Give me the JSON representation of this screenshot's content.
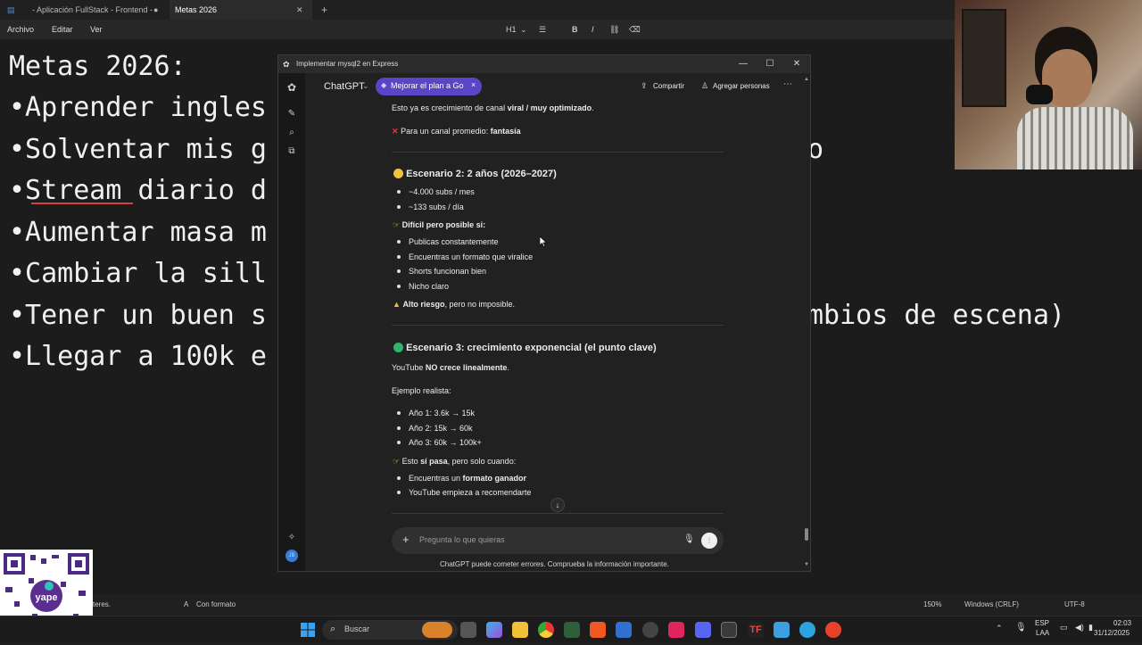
{
  "notepad": {
    "tabs": [
      "- Aplicación FullStack - Frontend -",
      "Metas 2026"
    ],
    "menu": [
      "Archivo",
      "Editar",
      "Ver"
    ],
    "toolbar": [
      "H1",
      "B",
      "I"
    ],
    "lines": [
      "Metas 2026:",
      "•Aprender ingles",
      "•Solventar mis g",
      "•Stream diario d",
      "•Aumentar masa m",
      "•Cambiar la sill",
      "•Tener un buen s",
      "•Llegar a 100k e"
    ],
    "right_fragments": [
      "o",
      "mbios de escena)"
    ],
    "status": {
      "left": "teres.",
      "format": "Con formato",
      "zoom": "150%",
      "eol": "Windows (CRLF)",
      "encoding": "UTF-8"
    }
  },
  "window": {
    "title": "Implementar mysql2 en Express",
    "controls": [
      "—",
      "☐",
      "✕"
    ]
  },
  "chat": {
    "model": "ChatGPT",
    "upgrade": "Mejorar el plan a Go",
    "share": "Compartir",
    "add_people": "Agregar personas",
    "l1a": "Esto ya es crecimiento de canal ",
    "l1b": "viral / muy optimizado",
    "l2a": "Para un canal promedio: ",
    "l2b": "fantasía",
    "s2_title": "Escenario 2: 2 años (2026–2027)",
    "s2_b1": "~4.000 subs / mes",
    "s2_b2": "~133 subs / día",
    "s2_hard": "Difícil pero posible si:",
    "s2_c1": "Publicas constantemente",
    "s2_c2": "Encuentras un formato que viralice",
    "s2_c3": "Shorts funcionan bien",
    "s2_c4": "Nicho claro",
    "s2_risk_b": "Alto riesgo",
    "s2_risk": ", pero no imposible.",
    "s3_title": "Escenario 3: crecimiento exponencial (el punto clave)",
    "s3_l1a": "YouTube ",
    "s3_l1b": "NO crece linealmente",
    "s3_l2": "Ejemplo realista:",
    "s3_y1": "Año 1: 3.6k → 15k",
    "s3_y2": "Año 2: 15k → 60k",
    "s3_y3": "Año 3: 60k → 100k+",
    "s3_p_a": "Esto ",
    "s3_p_b": "sí pasa",
    "s3_p_c": ", pero solo cuando:",
    "s3_e1a": "Encuentras un ",
    "s3_e1b": "formato ganador",
    "s3_e2": "YouTube empieza a recomendarte",
    "placeholder": "Pregunta lo que quieras",
    "disclaimer": "ChatGPT puede cometer errores. Comprueba la información importante."
  },
  "taskbar": {
    "search": "Buscar",
    "lang1": "ESP",
    "lang2": "LAA",
    "time": "02:03",
    "date": "31/12/2025"
  },
  "colors": {
    "accent": "#5b45c7",
    "yellow": "#f3c13a",
    "green": "#2fb36e",
    "red": "#e2373f"
  }
}
